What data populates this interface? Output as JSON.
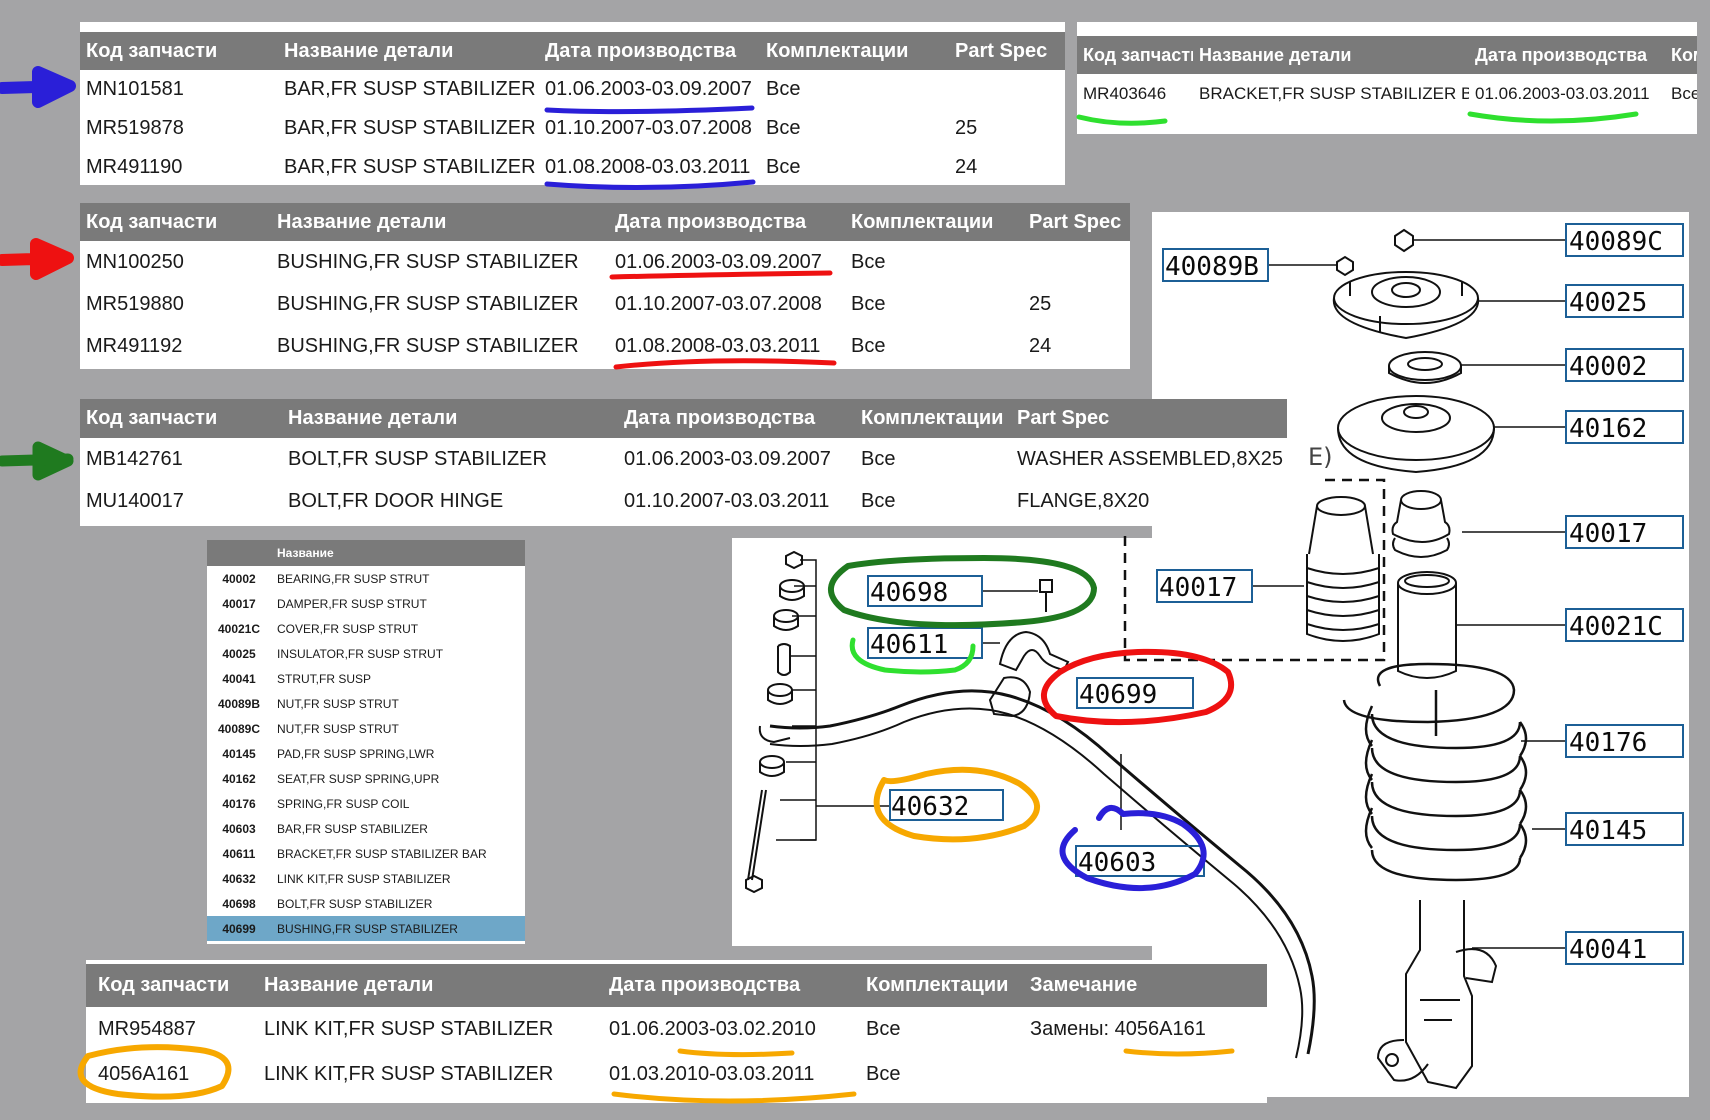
{
  "headers": {
    "code": "Код запчасти",
    "name": "Название детали",
    "date": "Дата производства",
    "equip": "Комплектации",
    "spec": "Part Spec",
    "equip_cut": "Комп",
    "note": "Замечание",
    "mini_name": "Название"
  },
  "table_bar": [
    {
      "code": "MN101581",
      "name": "BAR,FR SUSP STABILIZER",
      "date": "01.06.2003-03.09.2007",
      "equip": "Все",
      "spec": ""
    },
    {
      "code": "MR519878",
      "name": "BAR,FR SUSP STABILIZER",
      "date": "01.10.2007-03.07.2008",
      "equip": "Все",
      "spec": "25"
    },
    {
      "code": "MR491190",
      "name": "BAR,FR SUSP STABILIZER",
      "date": "01.08.2008-03.03.2011",
      "equip": "Все",
      "spec": "24"
    }
  ],
  "table_bracket": [
    {
      "code": "MR403646",
      "name": "BRACKET,FR SUSP STABILIZER BAR",
      "date": "01.06.2003-03.03.2011",
      "equip": "Все"
    }
  ],
  "table_bushing": [
    {
      "code": "MN100250",
      "name": "BUSHING,FR SUSP STABILIZER",
      "date": "01.06.2003-03.09.2007",
      "equip": "Все",
      "spec": ""
    },
    {
      "code": "MR519880",
      "name": "BUSHING,FR SUSP STABILIZER",
      "date": "01.10.2007-03.07.2008",
      "equip": "Все",
      "spec": "25"
    },
    {
      "code": "MR491192",
      "name": "BUSHING,FR SUSP STABILIZER",
      "date": "01.08.2008-03.03.2011",
      "equip": "Все",
      "spec": "24"
    }
  ],
  "table_bolt": [
    {
      "code": "MB142761",
      "name": "BOLT,FR SUSP STABILIZER",
      "date": "01.06.2003-03.09.2007",
      "equip": "Все",
      "spec": "WASHER ASSEMBLED,8X25"
    },
    {
      "code": "MU140017",
      "name": "BOLT,FR DOOR HINGE",
      "date": "01.10.2007-03.03.2011",
      "equip": "Все",
      "spec": "FLANGE,8X20"
    }
  ],
  "table_link": [
    {
      "code": "MR954887",
      "name": "LINK KIT,FR SUSP STABILIZER",
      "date": "01.06.2003-03.02.2010",
      "equip": "Все",
      "note_prefix": "Замены: ",
      "note_link": "4056A161"
    },
    {
      "code": "4056A161",
      "name": "LINK KIT,FR SUSP STABILIZER",
      "date": "01.03.2010-03.03.2011",
      "equip": "Все",
      "note_prefix": "",
      "note_link": ""
    }
  ],
  "parts_index": [
    {
      "code": "40002",
      "name": "BEARING,FR SUSP STRUT"
    },
    {
      "code": "40017",
      "name": "DAMPER,FR SUSP STRUT"
    },
    {
      "code": "40021C",
      "name": "COVER,FR SUSP STRUT"
    },
    {
      "code": "40025",
      "name": "INSULATOR,FR SUSP STRUT"
    },
    {
      "code": "40041",
      "name": "STRUT,FR SUSP"
    },
    {
      "code": "40089B",
      "name": "NUT,FR SUSP STRUT"
    },
    {
      "code": "40089C",
      "name": "NUT,FR SUSP STRUT"
    },
    {
      "code": "40145",
      "name": "PAD,FR SUSP SPRING,LWR"
    },
    {
      "code": "40162",
      "name": "SEAT,FR SUSP SPRING,UPR"
    },
    {
      "code": "40176",
      "name": "SPRING,FR SUSP COIL"
    },
    {
      "code": "40603",
      "name": "BAR,FR SUSP STABILIZER"
    },
    {
      "code": "40611",
      "name": "BRACKET,FR SUSP STABILIZER BAR"
    },
    {
      "code": "40632",
      "name": "LINK KIT,FR SUSP STABILIZER"
    },
    {
      "code": "40698",
      "name": "BOLT,FR SUSP STABILIZER"
    },
    {
      "code": "40699",
      "name": "BUSHING,FR SUSP STABILIZER"
    }
  ],
  "selected_part": "40699",
  "strut_callouts": {
    "c40089C": "40089C",
    "c40089B": "40089B",
    "c40025": "40025",
    "c40002": "40002",
    "c40162": "40162",
    "c40017a": "40017",
    "c40017b": "40017",
    "c40021C": "40021C",
    "c40176": "40176",
    "c40145": "40145",
    "c40041": "40041"
  },
  "stab_callouts": {
    "c40698": "40698",
    "c40611": "40611",
    "c40699": "40699",
    "c40632": "40632",
    "c40603": "40603"
  },
  "diagram_fragment": "E)",
  "colors": {
    "blue": "#2a1fd8",
    "red": "#ee1111",
    "dark_green": "#1f7a1f",
    "light_green": "#2fe02f",
    "orange": "#f7a800",
    "header_gray": "#7a7a7a",
    "selected_row": "#6ea7c8",
    "callout_border": "#1c5f96"
  }
}
